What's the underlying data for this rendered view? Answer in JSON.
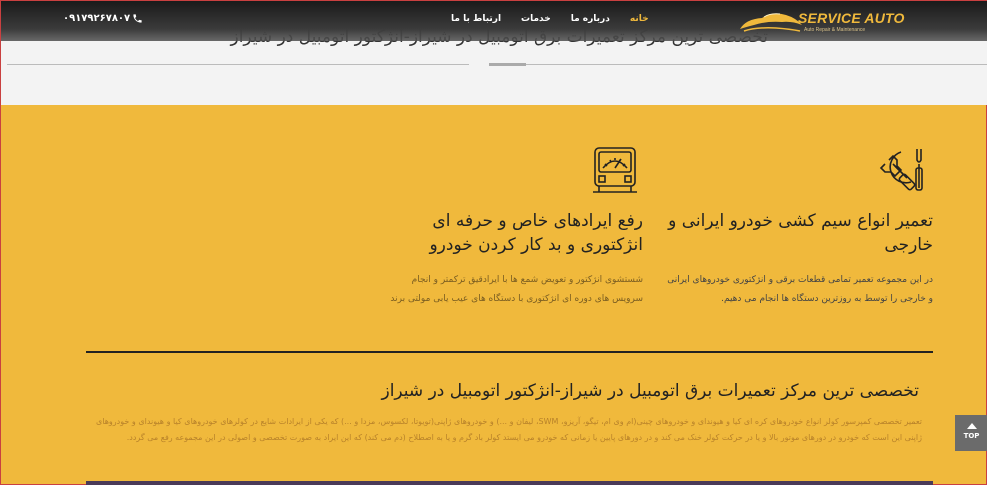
{
  "header": {
    "phone": "۰۹۱۷۹۲۶۷۸۰۷",
    "nav": [
      "خانه",
      "درباره ما",
      "خدمات",
      "ارتباط با ما"
    ],
    "logo_text": "SERVICE AUTO",
    "logo_sub": "Auto Repair & Maintenance"
  },
  "hero": {
    "title": "تخصصی ترین مرکز تعمیرات برق اتومبیل در شیراز-انژکتور اتومبیل در شیراز"
  },
  "features": [
    {
      "icon": "tools-icon",
      "title": "تعمیر انواع سیم کشی خودرو ایرانی و خارجی",
      "text": "در این مجموعه تعمیر تمامی قطعات برقی و انژکتوری خودروهای ایرانی و خارجی را توسط به روزترین دستگاه ها انجام می دهیم."
    },
    {
      "icon": "diagnostic-gauge-icon",
      "title": "رفع ایرادهای خاص و حرفه ای انژکتوری و بد کار کردن خودرو",
      "text": "شستشوی انژکتور و تعویض شمع ها با ایرادقیق ترکمتر و انجام سرویس های دوره ای انژکتوری با دستگاه های عیب یابی مولتی برند"
    }
  ],
  "section": {
    "title": "تخصصی ترین مرکز تعمیرات برق اتومبیل در شیراز-انژکتور اتومبیل در شیراز",
    "body": "تعمیر تخصصی کمپرسور کولر انواع خودروهای کره ای کیا و هیوندای و خودروهای چینی(ام وی ام، تیگو، آریزو، SWM، لیفان و ...) و خودروهای ژاپنی(تویوتا، لکسوس، مزدا و ...) که یکی از ایرادات شایع در کولرهای خودروهای کیا و هیوندای و خودروهای ژاپنی این است که خودرو در دورهای موتور بالا و یا در حرکت کولر خنک می کند و در دورهای پایین یا زمانی که خودرو می ایستد کولر باد گرم و یا به اصطلاح (دم می کند) که این ایراد به صورت تخصصی و اصولی در این مجموعه رفع می گردد."
  },
  "top_button": "TOP",
  "colors": {
    "accent": "#f0b93c",
    "navbar": "#2a2a2a"
  }
}
